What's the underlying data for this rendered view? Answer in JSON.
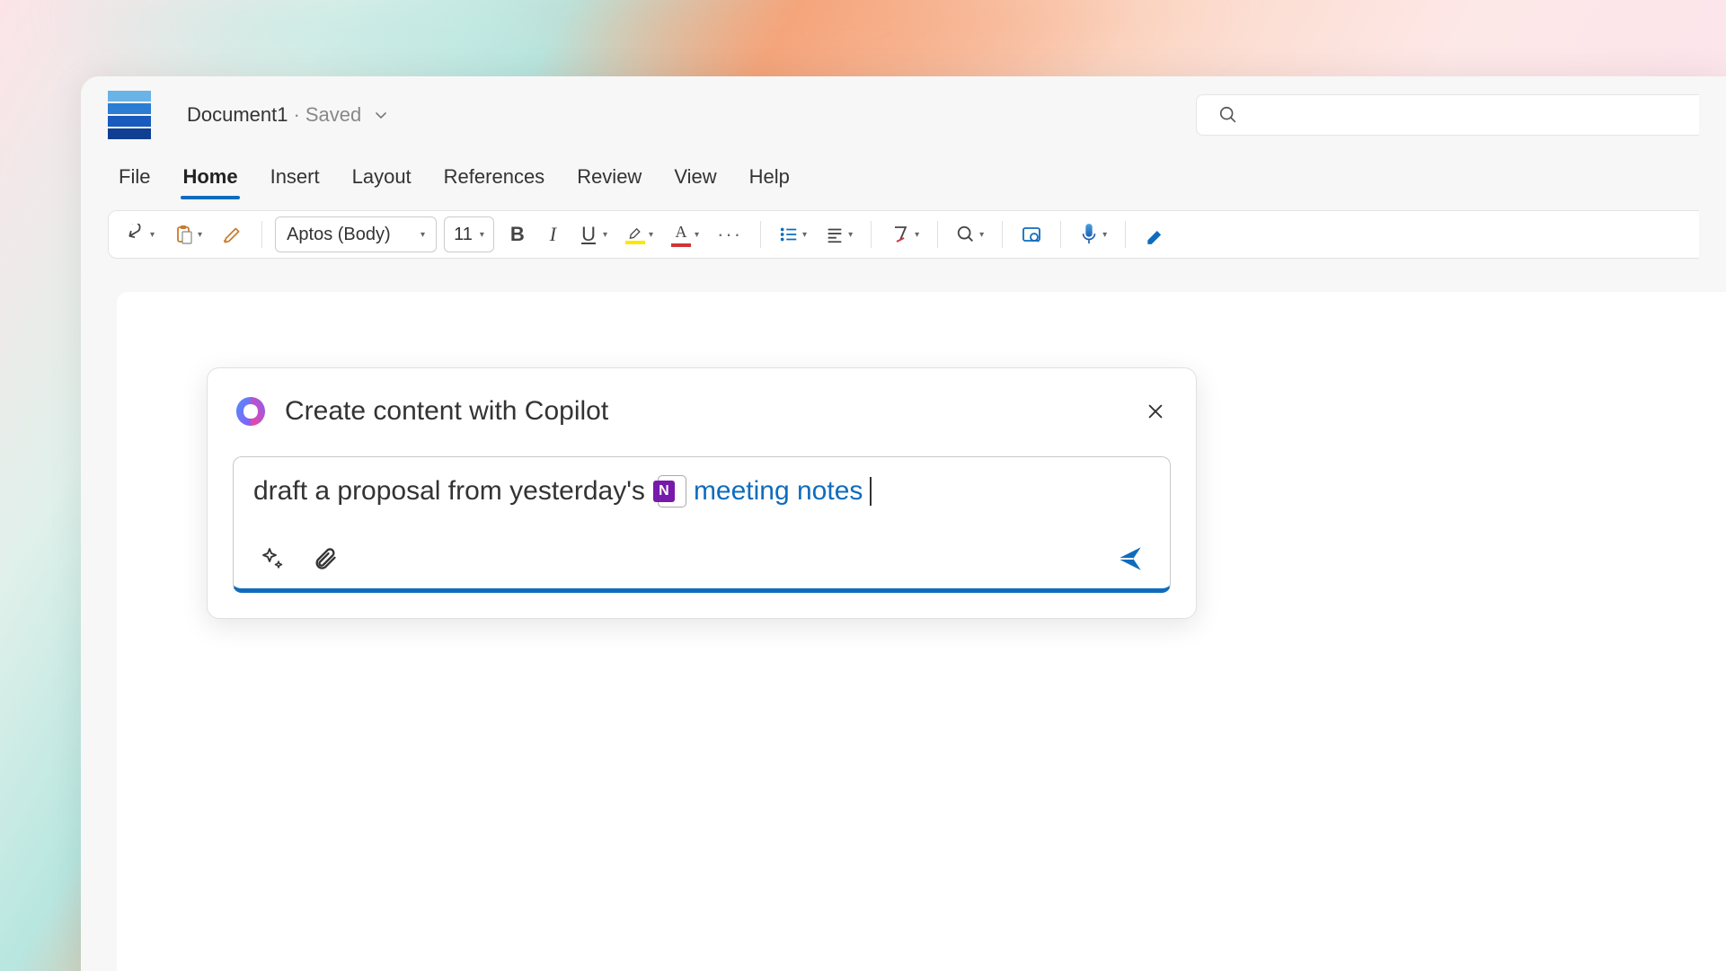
{
  "header": {
    "doc_name": "Document1",
    "separator": "·",
    "status": "Saved"
  },
  "tabs": {
    "file": "File",
    "home": "Home",
    "insert": "Insert",
    "layout": "Layout",
    "references": "References",
    "review": "Review",
    "view": "View",
    "help": "Help"
  },
  "toolbar": {
    "font_name": "Aptos (Body)",
    "font_size": "11",
    "bold": "B",
    "italic": "I",
    "underline": "U",
    "font_color_letter": "A",
    "more": "···"
  },
  "copilot": {
    "title": "Create content with Copilot",
    "prompt_text": "draft a proposal from yesterday's",
    "onenote_badge": "N",
    "file_ref": "meeting notes"
  }
}
